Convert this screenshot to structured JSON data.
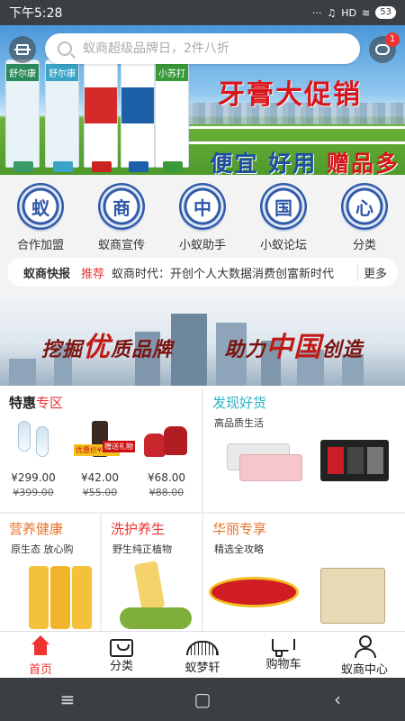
{
  "status_bar": {
    "time": "下午5:28",
    "signal": "HD",
    "battery": "53"
  },
  "search": {
    "placeholder": "蚁商超级品牌日，2件八折",
    "message_badge": "1"
  },
  "banner": {
    "title": "牙膏大促销",
    "subtitle_parts": [
      "便宜",
      "好用",
      "赠品多"
    ],
    "product_labels": [
      "舒尔康",
      "舒尔康",
      "",
      "",
      "小苏打"
    ]
  },
  "categories": [
    {
      "char": "蚁",
      "label": "合作加盟"
    },
    {
      "char": "商",
      "label": "蚁商宣传"
    },
    {
      "char": "中",
      "label": "小蚁助手"
    },
    {
      "char": "国",
      "label": "小蚁论坛"
    },
    {
      "char": "心",
      "label": "分类"
    }
  ],
  "news": {
    "label": "蚁商快报",
    "tag": "推荐",
    "text": "蚁商时代：开创个人大数据消费创富新时代",
    "more": "更多"
  },
  "city_banner": {
    "part1": "挖掘",
    "big1": "优",
    "part2": "质品牌",
    "part3": "助力",
    "big2": "中国",
    "part4": "创造"
  },
  "deals": {
    "title_main": "特惠",
    "title_accent": "专区",
    "items": [
      {
        "price": "¥299.00",
        "old_price": "¥399.00"
      },
      {
        "price": "¥42.00",
        "old_price": "¥55.00",
        "tag1": "优惠价¥42.0",
        "tag2": "赠送礼物"
      },
      {
        "price": "¥68.00",
        "old_price": "¥88.00"
      }
    ]
  },
  "panels": {
    "discover": {
      "title": "发现好货",
      "sub": "高品质生活",
      "color": "#2ab5c4"
    },
    "nutrition": {
      "title": "营养健康",
      "sub": "原生态 放心购",
      "color": "#e8732a"
    },
    "care": {
      "title": "洗护养生",
      "sub": "野生纯正植物",
      "color": "#e33"
    },
    "luxury": {
      "title": "华丽专享",
      "sub": "精选全攻略",
      "color": "#e8732a"
    }
  },
  "bottom_nav": [
    {
      "label": "首页",
      "icon": "home-icon",
      "active": true
    },
    {
      "label": "分类",
      "icon": "bag-icon"
    },
    {
      "label": "蚁梦轩",
      "icon": "fan-icon"
    },
    {
      "label": "购物车",
      "icon": "cart-icon"
    },
    {
      "label": "蚁商中心",
      "icon": "user-icon"
    }
  ],
  "colors": {
    "accent_red": "#e33",
    "status_bar": "#3a3f44",
    "plate_blue": "#2e58a8"
  }
}
